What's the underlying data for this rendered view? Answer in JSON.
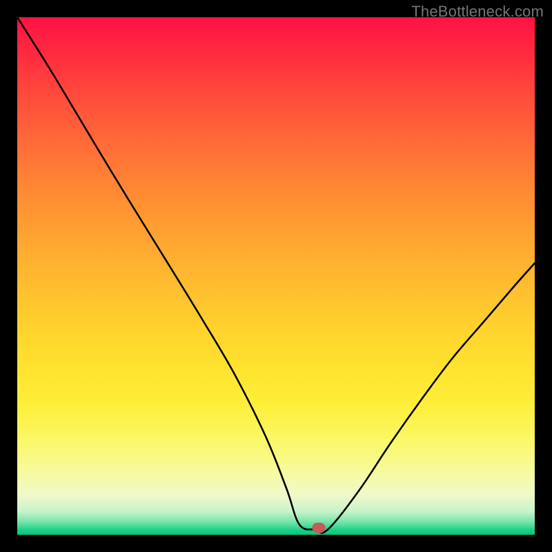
{
  "watermark": "TheBottleneck.com",
  "colors": {
    "frame": "#000000",
    "watermark_text": "#757575",
    "curve": "#000000",
    "marker": "#c55a56"
  },
  "chart_data": {
    "type": "line",
    "title": "",
    "xlabel": "",
    "ylabel": "",
    "xlim": [
      0,
      100
    ],
    "ylim": [
      0,
      100
    ],
    "grid": false,
    "legend": false,
    "series": [
      {
        "name": "curve",
        "x": [
          0,
          6,
          12,
          18,
          24,
          30,
          36,
          42,
          48,
          52,
          54.5,
          57.5,
          60,
          66,
          72,
          78,
          84,
          90,
          96,
          100
        ],
        "y": [
          100,
          90.5,
          80.5,
          70.5,
          60.7,
          51,
          41.2,
          31,
          19,
          9,
          2,
          1,
          1,
          8.5,
          17.5,
          26,
          34,
          41,
          48,
          52.5
        ]
      }
    ],
    "marker": {
      "x": 58.3,
      "y": 1.3
    },
    "background_gradient": {
      "top": "#ff1244",
      "mid": "#ffe32e",
      "bottom": "#00c97d"
    }
  }
}
